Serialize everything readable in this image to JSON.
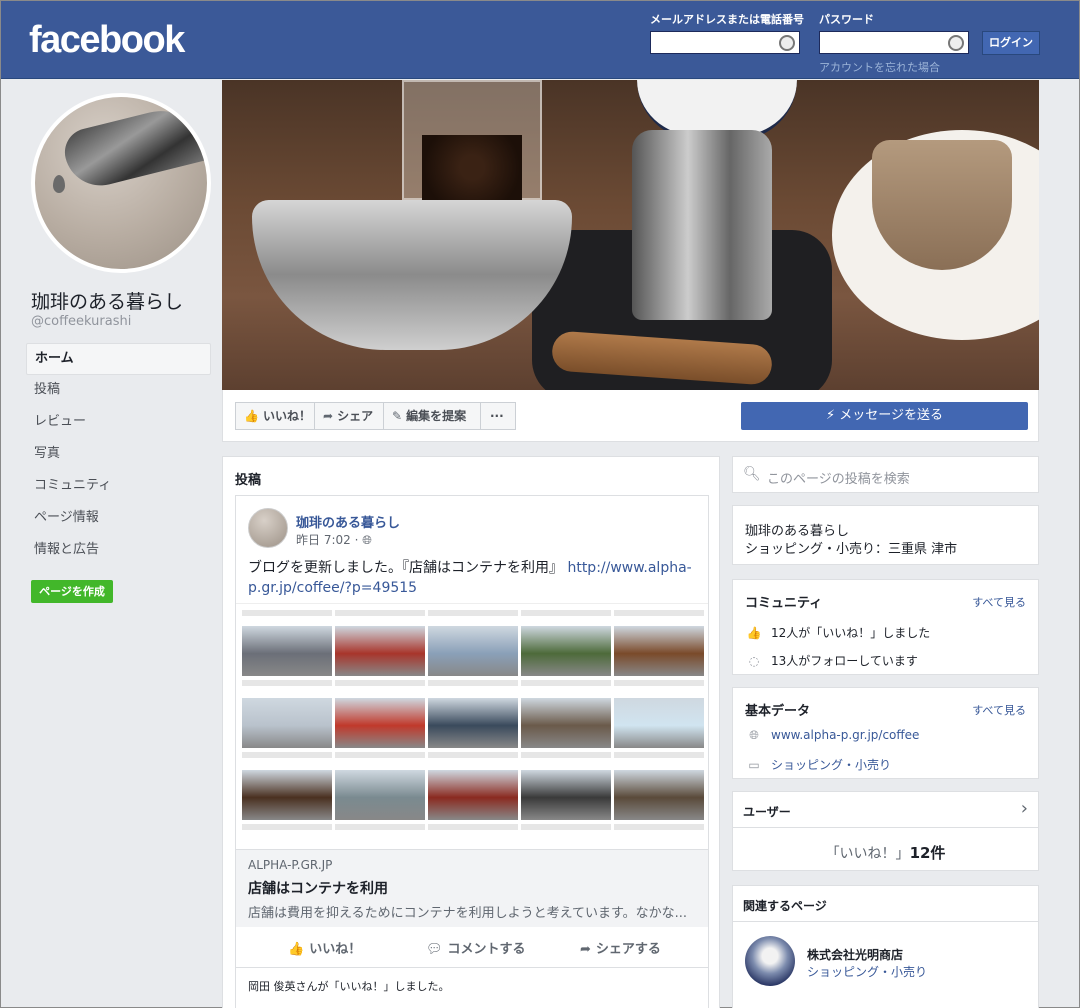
{
  "header": {
    "logo": "facebook",
    "email_label": "メールアドレスまたは電話番号",
    "password_label": "パスワード",
    "login_button": "ログイン",
    "forgot_link": "アカウントを忘れた場合",
    "brand_color": "#3b5998"
  },
  "profile": {
    "name": "珈琲のある暮らし",
    "handle": "@coffeekurashi"
  },
  "nav": {
    "items": [
      "ホーム",
      "投稿",
      "レビュー",
      "写真",
      "コミュニティ",
      "ページ情報",
      "情報と広告"
    ],
    "create_page": "ページを作成"
  },
  "actions": {
    "like": "いいね！",
    "share": "シェア",
    "suggest_edit": "編集を提案",
    "more": "···",
    "message": "メッセージを送る"
  },
  "posts": {
    "title": "投稿",
    "post": {
      "author": "珈琲のある暮らし",
      "time": "昨日 7:02 · ",
      "text": "ブログを更新しました。『店舗はコンテナを利用』",
      "link": "http://www.alpha-p.gr.jp/coffee/?p=49515",
      "domain": "ALPHA-P.GR.JP",
      "link_title": "店舗はコンテナを利用",
      "link_desc": "店舗は費用を抑えるためにコンテナを利用しようと考えています。なかな...",
      "like_action": "いいね！",
      "comment_action": "コメントする",
      "share_action": "シェアする",
      "liked_by": "岡田 俊英さんが「いいね！」しました。"
    }
  },
  "sidebar": {
    "search_placeholder": "このページの投稿を検索",
    "about_name": "珈琲のある暮らし",
    "about_category": "ショッピング・小売り：三重県 津市",
    "community": {
      "title": "コミュニティ",
      "see_all": "すべて見る",
      "likes": "12人が「いいね！」しました",
      "follows": "13人がフォローしています"
    },
    "basic": {
      "title": "基本データ",
      "see_all": "すべて見る",
      "website": "www.alpha-p.gr.jp/coffee",
      "category": "ショッピング・小売り"
    },
    "users": {
      "title": "ユーザー",
      "likes_prefix": "「いいね！」",
      "likes_count": "12件"
    },
    "related": {
      "title": "関連するページ",
      "name": "株式会社光明商店",
      "category": "ショッピング・小売り"
    }
  }
}
